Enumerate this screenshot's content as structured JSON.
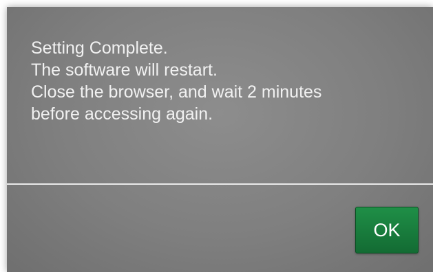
{
  "dialog": {
    "message_lines": [
      "Setting Complete.",
      "The software will restart.",
      "Close the browser, and wait 2 minutes",
      "before accessing again."
    ],
    "ok_label": "OK"
  },
  "colors": {
    "dialog_background": "#808080",
    "message_text": "#f1f1f1",
    "divider": "#eaeaea",
    "ok_button": "#1a7d3d"
  }
}
